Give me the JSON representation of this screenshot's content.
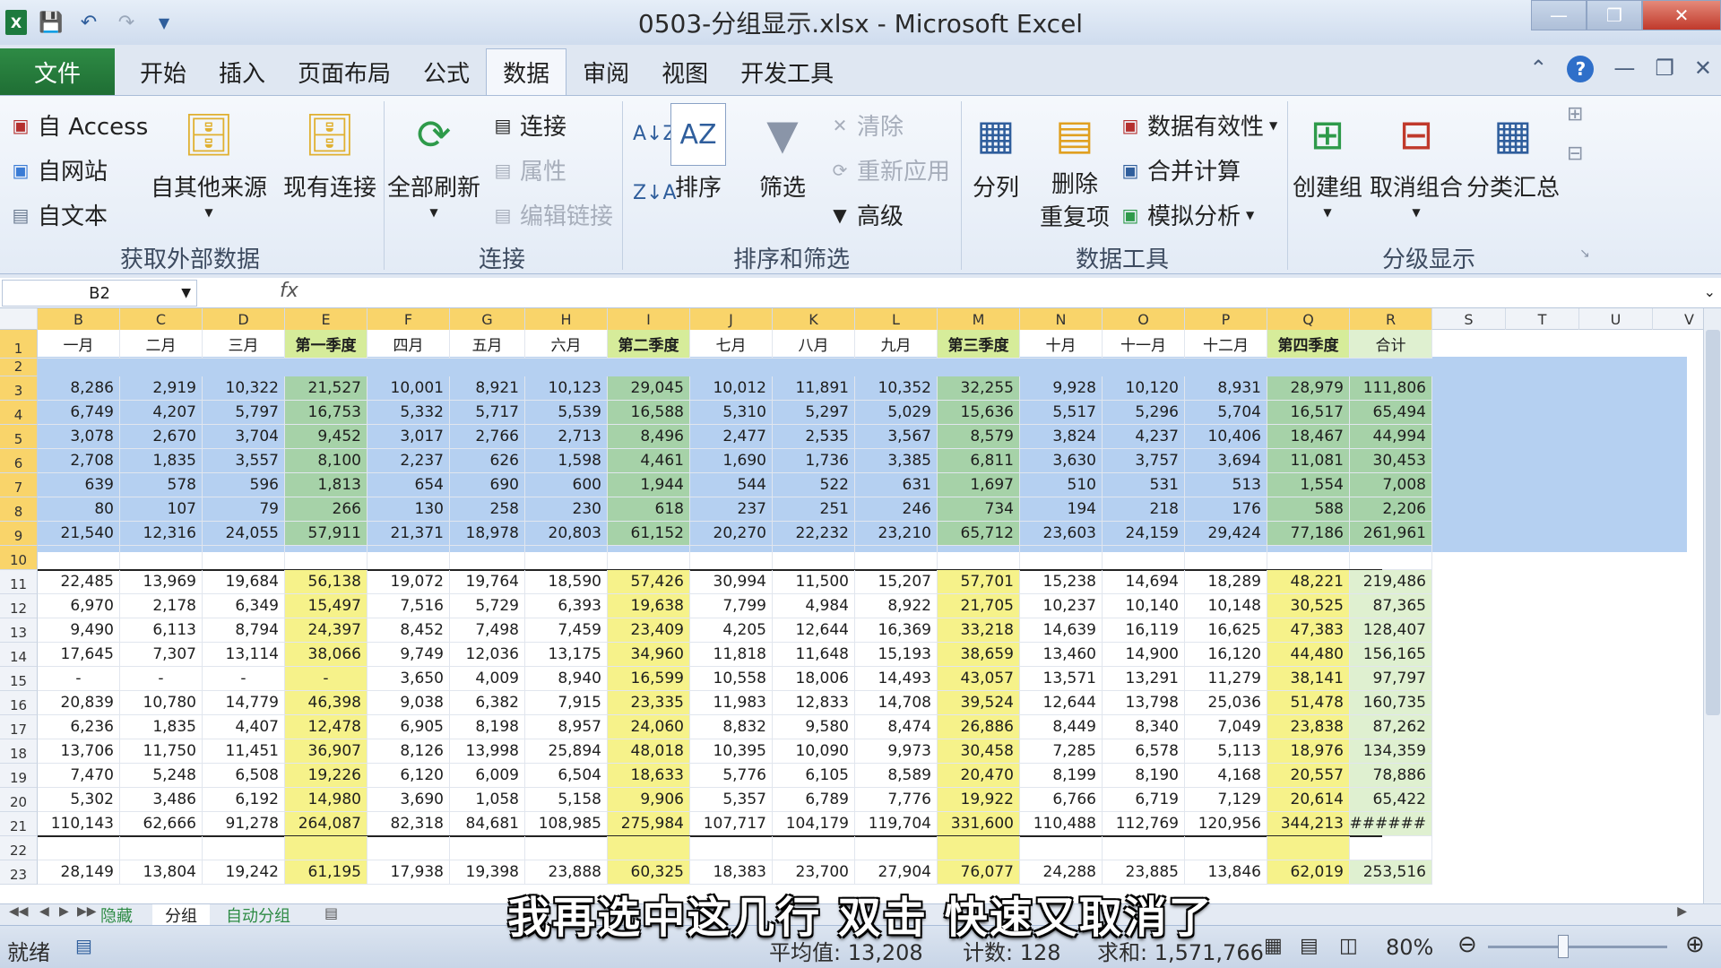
{
  "window": {
    "title": "0503-分组显示.xlsx - Microsoft Excel"
  },
  "menu": {
    "file": "文件",
    "tabs": [
      "开始",
      "插入",
      "页面布局",
      "公式",
      "数据",
      "审阅",
      "视图",
      "开发工具"
    ],
    "active": "数据"
  },
  "ribbon": {
    "ext": {
      "access": "自 Access",
      "web": "自网站",
      "text": "自文本",
      "other": "自其他来源",
      "existing": "现有连接",
      "group": "获取外部数据"
    },
    "conn": {
      "refresh": "全部刷新",
      "connections": "连接",
      "properties": "属性",
      "editlinks": "编辑链接",
      "group": "连接"
    },
    "sort": {
      "sort": "排序",
      "filter": "筛选",
      "clear": "清除",
      "reapply": "重新应用",
      "advanced": "高级",
      "group": "排序和筛选"
    },
    "tools": {
      "split": "分列",
      "remove1": "删除",
      "remove2": "重复项",
      "validation": "数据有效性",
      "consolidate": "合并计算",
      "whatif": "模拟分析",
      "group": "数据工具"
    },
    "outline": {
      "group_btn": "创建组",
      "ungroup": "取消组合",
      "subtotal": "分类汇总",
      "group": "分级显示"
    }
  },
  "formula": {
    "namebox": "B2",
    "fx": "fx"
  },
  "grid": {
    "columns": [
      "B",
      "C",
      "D",
      "E",
      "F",
      "G",
      "H",
      "I",
      "J",
      "K",
      "L",
      "M",
      "N",
      "O",
      "P",
      "Q",
      "R",
      "S",
      "T",
      "U",
      "V"
    ],
    "headers": [
      "一月",
      "二月",
      "三月",
      "第一季度",
      "四月",
      "五月",
      "六月",
      "第二季度",
      "七月",
      "八月",
      "九月",
      "第三季度",
      "十月",
      "十一月",
      "十二月",
      "第四季度",
      "合计"
    ],
    "rows": [
      {
        "n": "3",
        "v": [
          "8,286",
          "2,919",
          "10,322",
          "21,527",
          "10,001",
          "8,921",
          "10,123",
          "29,045",
          "10,012",
          "11,891",
          "10,352",
          "32,255",
          "9,928",
          "10,120",
          "8,931",
          "28,979",
          "111,806"
        ]
      },
      {
        "n": "4",
        "v": [
          "6,749",
          "4,207",
          "5,797",
          "16,753",
          "5,332",
          "5,717",
          "5,539",
          "16,588",
          "5,310",
          "5,297",
          "5,029",
          "15,636",
          "5,517",
          "5,296",
          "5,704",
          "16,517",
          "65,494"
        ]
      },
      {
        "n": "5",
        "v": [
          "3,078",
          "2,670",
          "3,704",
          "9,452",
          "3,017",
          "2,766",
          "2,713",
          "8,496",
          "2,477",
          "2,535",
          "3,567",
          "8,579",
          "3,824",
          "4,237",
          "10,406",
          "18,467",
          "44,994"
        ]
      },
      {
        "n": "6",
        "v": [
          "2,708",
          "1,835",
          "3,557",
          "8,100",
          "2,237",
          "626",
          "1,598",
          "4,461",
          "1,690",
          "1,736",
          "3,385",
          "6,811",
          "3,630",
          "3,757",
          "3,694",
          "11,081",
          "30,453"
        ]
      },
      {
        "n": "7",
        "v": [
          "639",
          "578",
          "596",
          "1,813",
          "654",
          "690",
          "600",
          "1,944",
          "544",
          "522",
          "631",
          "1,697",
          "510",
          "531",
          "513",
          "1,554",
          "7,008"
        ]
      },
      {
        "n": "8",
        "v": [
          "80",
          "107",
          "79",
          "266",
          "130",
          "258",
          "230",
          "618",
          "237",
          "251",
          "246",
          "734",
          "194",
          "218",
          "176",
          "588",
          "2,206"
        ]
      },
      {
        "n": "9",
        "v": [
          "21,540",
          "12,316",
          "24,055",
          "57,911",
          "21,371",
          "18,978",
          "20,803",
          "61,152",
          "20,270",
          "22,232",
          "23,210",
          "65,712",
          "23,603",
          "24,159",
          "29,424",
          "77,186",
          "261,961"
        ]
      },
      {
        "n": "10",
        "v": [
          "",
          "",
          "",
          "",
          "",
          "",
          "",
          "",
          "",
          "",
          "",
          "",
          "",
          "",
          "",
          "",
          ""
        ]
      },
      {
        "n": "11",
        "v": [
          "22,485",
          "13,969",
          "19,684",
          "56,138",
          "19,072",
          "19,764",
          "18,590",
          "57,426",
          "30,994",
          "11,500",
          "15,207",
          "57,701",
          "15,238",
          "14,694",
          "18,289",
          "48,221",
          "219,486"
        ]
      },
      {
        "n": "12",
        "v": [
          "6,970",
          "2,178",
          "6,349",
          "15,497",
          "7,516",
          "5,729",
          "6,393",
          "19,638",
          "7,799",
          "4,984",
          "8,922",
          "21,705",
          "10,237",
          "10,140",
          "10,148",
          "30,525",
          "87,365"
        ]
      },
      {
        "n": "13",
        "v": [
          "9,490",
          "6,113",
          "8,794",
          "24,397",
          "8,452",
          "7,498",
          "7,459",
          "23,409",
          "4,205",
          "12,644",
          "16,369",
          "33,218",
          "14,639",
          "16,119",
          "16,625",
          "47,383",
          "128,407"
        ]
      },
      {
        "n": "14",
        "v": [
          "17,645",
          "7,307",
          "13,114",
          "38,066",
          "9,749",
          "12,036",
          "13,175",
          "34,960",
          "11,818",
          "11,648",
          "15,193",
          "38,659",
          "13,460",
          "14,900",
          "16,120",
          "44,480",
          "156,165"
        ]
      },
      {
        "n": "15",
        "v": [
          "-",
          "-",
          "-",
          "-",
          "3,650",
          "4,009",
          "8,940",
          "16,599",
          "10,558",
          "18,006",
          "14,493",
          "43,057",
          "13,571",
          "13,291",
          "11,279",
          "38,141",
          "97,797"
        ]
      },
      {
        "n": "16",
        "v": [
          "20,839",
          "10,780",
          "14,779",
          "46,398",
          "9,038",
          "6,382",
          "7,915",
          "23,335",
          "11,983",
          "12,833",
          "14,708",
          "39,524",
          "12,644",
          "13,798",
          "25,036",
          "51,478",
          "160,735"
        ]
      },
      {
        "n": "17",
        "v": [
          "6,236",
          "1,835",
          "4,407",
          "12,478",
          "6,905",
          "8,198",
          "8,957",
          "24,060",
          "8,832",
          "9,580",
          "8,474",
          "26,886",
          "8,449",
          "8,340",
          "7,049",
          "23,838",
          "87,262"
        ]
      },
      {
        "n": "18",
        "v": [
          "13,706",
          "11,750",
          "11,451",
          "36,907",
          "8,126",
          "13,998",
          "25,894",
          "48,018",
          "10,395",
          "10,090",
          "9,973",
          "30,458",
          "7,285",
          "6,578",
          "5,113",
          "18,976",
          "134,359"
        ]
      },
      {
        "n": "19",
        "v": [
          "7,470",
          "5,248",
          "6,508",
          "19,226",
          "6,120",
          "6,009",
          "6,504",
          "18,633",
          "5,776",
          "6,105",
          "8,589",
          "20,470",
          "8,199",
          "8,190",
          "4,168",
          "20,557",
          "78,886"
        ]
      },
      {
        "n": "20",
        "v": [
          "5,302",
          "3,486",
          "6,192",
          "14,980",
          "3,690",
          "1,058",
          "5,158",
          "9,906",
          "5,357",
          "6,789",
          "7,776",
          "19,922",
          "6,766",
          "6,719",
          "7,129",
          "20,614",
          "65,422"
        ]
      },
      {
        "n": "21",
        "v": [
          "110,143",
          "62,666",
          "91,278",
          "264,087",
          "82,318",
          "84,681",
          "108,985",
          "275,984",
          "107,717",
          "104,179",
          "119,704",
          "331,600",
          "110,488",
          "112,769",
          "120,956",
          "344,213",
          "########"
        ]
      },
      {
        "n": "22",
        "v": [
          "",
          "",
          "",
          "",
          "",
          "",
          "",
          "",
          "",
          "",
          "",
          "",
          "",
          "",
          "",
          "",
          ""
        ]
      },
      {
        "n": "23",
        "v": [
          "28,149",
          "13,804",
          "19,242",
          "61,195",
          "17,938",
          "19,398",
          "23,888",
          "60,325",
          "18,383",
          "23,700",
          "27,904",
          "76,077",
          "24,288",
          "23,885",
          "13,846",
          "62,019",
          "253,516"
        ]
      }
    ]
  },
  "sheets": {
    "tabs": [
      "隐藏",
      "分组",
      "自动分组"
    ],
    "active": "分组"
  },
  "status": {
    "ready": "就绪",
    "average": "平均值: 13,208",
    "count": "计数: 128",
    "sum": "求和: 1,571,766",
    "zoom": "80%"
  },
  "subtitle": "我再选中这几行 双击 快速又取消了",
  "colors": {
    "quarter_fill": "#d6ec9a",
    "quarter_fill_sel": "#a6d2a8",
    "total_fill": "#dff0d0",
    "header_fill": "#f9d46a",
    "selection": "#78aae6",
    "file_tab": "#217346"
  }
}
